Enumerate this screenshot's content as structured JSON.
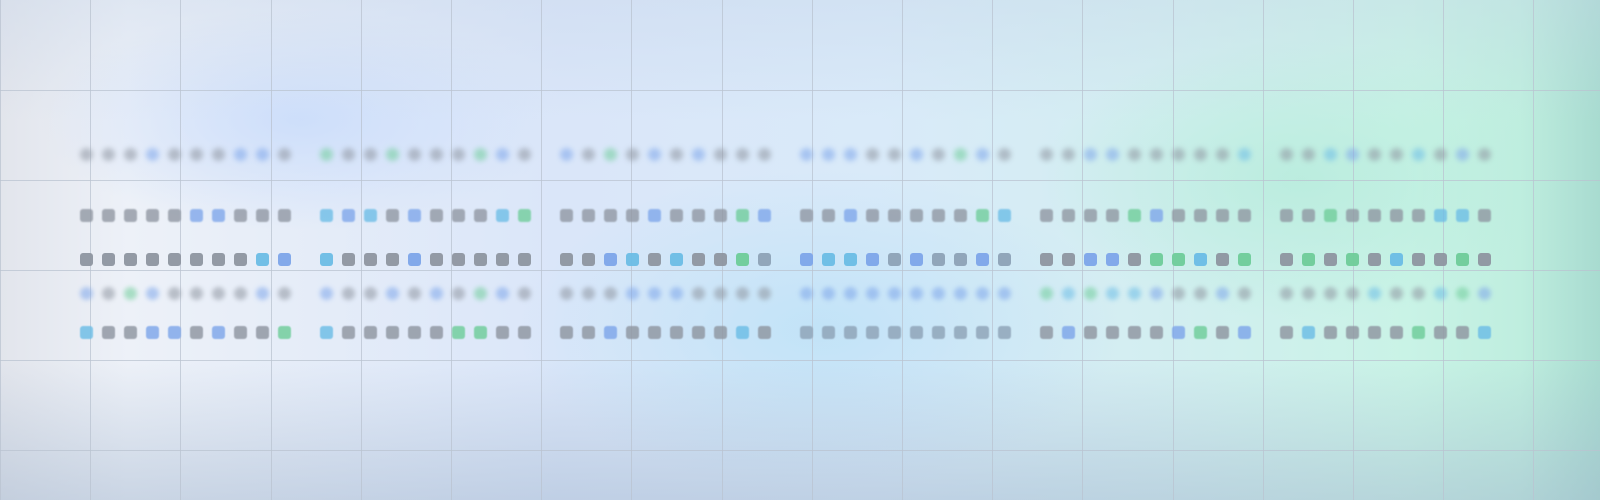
{
  "colors": {
    "gray": "#8f96a1",
    "blue": "#7ea6ea",
    "cyan": "#6cbde6",
    "green": "#6fcd9a",
    "slate": "#8ea3b7",
    "grid_line": "#b9c3d0",
    "bg_left": "#e7ebf3",
    "bg_mid": "#dbe8f8",
    "bg_right": "#cdf1e6",
    "bg_edge_right": "#a8dbd0"
  },
  "dot_rows": [
    {
      "style": "blurred",
      "groups": [
        [
          "gray",
          "gray",
          "gray",
          "blue",
          "gray",
          "gray",
          "gray",
          "blue",
          "blue",
          "gray"
        ],
        [
          "green",
          "gray",
          "gray",
          "green",
          "gray",
          "gray",
          "gray",
          "green",
          "blue",
          "gray"
        ],
        [
          "blue",
          "gray",
          "green",
          "gray",
          "blue",
          "gray",
          "blue",
          "gray",
          "gray",
          "gray"
        ],
        [
          "blue",
          "blue",
          "blue",
          "gray",
          "gray",
          "blue",
          "gray",
          "green",
          "blue",
          "gray"
        ],
        [
          "gray",
          "gray",
          "blue",
          "blue",
          "gray",
          "gray",
          "gray",
          "gray",
          "gray",
          "cyan"
        ],
        [
          "gray",
          "gray",
          "cyan",
          "blue",
          "gray",
          "gray",
          "cyan",
          "gray",
          "blue",
          "gray"
        ]
      ]
    },
    {
      "style": "soft",
      "groups": [
        [
          "gray",
          "gray",
          "gray",
          "gray",
          "gray",
          "blue",
          "blue",
          "gray",
          "gray",
          "gray"
        ],
        [
          "cyan",
          "blue",
          "cyan",
          "gray",
          "blue",
          "gray",
          "gray",
          "gray",
          "cyan",
          "green"
        ],
        [
          "gray",
          "gray",
          "gray",
          "gray",
          "blue",
          "gray",
          "gray",
          "gray",
          "green",
          "blue"
        ],
        [
          "gray",
          "gray",
          "blue",
          "gray",
          "gray",
          "gray",
          "gray",
          "gray",
          "green",
          "cyan"
        ],
        [
          "gray",
          "gray",
          "gray",
          "gray",
          "green",
          "blue",
          "gray",
          "gray",
          "gray",
          "gray"
        ],
        [
          "gray",
          "gray",
          "green",
          "gray",
          "gray",
          "gray",
          "gray",
          "cyan",
          "cyan",
          "gray"
        ]
      ]
    },
    {
      "style": "sharp",
      "groups": [
        [
          "gray",
          "gray",
          "gray",
          "gray",
          "gray",
          "gray",
          "gray",
          "gray",
          "cyan",
          "blue"
        ],
        [
          "cyan",
          "gray",
          "gray",
          "gray",
          "blue",
          "gray",
          "gray",
          "gray",
          "gray",
          "gray"
        ],
        [
          "gray",
          "gray",
          "blue",
          "cyan",
          "gray",
          "cyan",
          "gray",
          "gray",
          "green",
          "slate"
        ],
        [
          "blue",
          "cyan",
          "cyan",
          "blue",
          "slate",
          "blue",
          "slate",
          "slate",
          "blue",
          "slate"
        ],
        [
          "gray",
          "gray",
          "blue",
          "blue",
          "gray",
          "green",
          "green",
          "cyan",
          "gray",
          "green"
        ],
        [
          "gray",
          "green",
          "gray",
          "green",
          "gray",
          "cyan",
          "gray",
          "gray",
          "green",
          "gray"
        ]
      ]
    },
    {
      "style": "blurred",
      "groups": [
        [
          "blue",
          "gray",
          "green",
          "blue",
          "gray",
          "gray",
          "gray",
          "gray",
          "blue",
          "gray"
        ],
        [
          "blue",
          "gray",
          "gray",
          "blue",
          "gray",
          "blue",
          "gray",
          "green",
          "blue",
          "gray"
        ],
        [
          "gray",
          "gray",
          "gray",
          "blue",
          "blue",
          "blue",
          "gray",
          "gray",
          "gray",
          "gray"
        ],
        [
          "blue",
          "blue",
          "blue",
          "blue",
          "blue",
          "blue",
          "blue",
          "blue",
          "blue",
          "blue"
        ],
        [
          "green",
          "cyan",
          "green",
          "cyan",
          "cyan",
          "blue",
          "gray",
          "gray",
          "blue",
          "gray"
        ],
        [
          "gray",
          "gray",
          "gray",
          "gray",
          "cyan",
          "gray",
          "gray",
          "cyan",
          "green",
          "blue"
        ]
      ]
    },
    {
      "style": "soft",
      "groups": [
        [
          "cyan",
          "gray",
          "gray",
          "blue",
          "blue",
          "gray",
          "blue",
          "gray",
          "gray",
          "green"
        ],
        [
          "cyan",
          "gray",
          "gray",
          "gray",
          "gray",
          "gray",
          "green",
          "green",
          "gray",
          "gray"
        ],
        [
          "gray",
          "gray",
          "blue",
          "gray",
          "gray",
          "gray",
          "gray",
          "gray",
          "cyan",
          "gray"
        ],
        [
          "slate",
          "slate",
          "slate",
          "slate",
          "slate",
          "slate",
          "slate",
          "slate",
          "slate",
          "slate"
        ],
        [
          "gray",
          "blue",
          "gray",
          "gray",
          "gray",
          "gray",
          "blue",
          "green",
          "gray",
          "blue"
        ],
        [
          "gray",
          "cyan",
          "gray",
          "gray",
          "gray",
          "gray",
          "green",
          "gray",
          "gray",
          "cyan"
        ]
      ]
    }
  ]
}
